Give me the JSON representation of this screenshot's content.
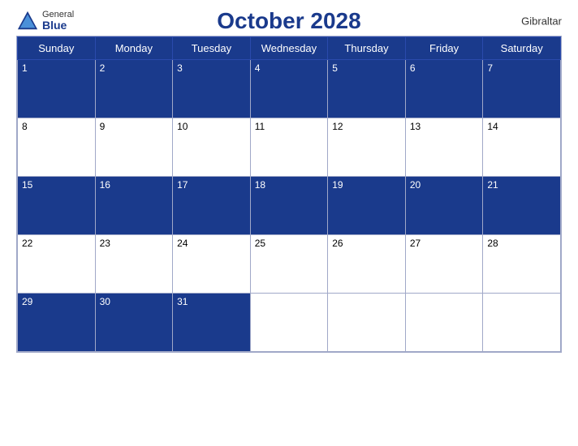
{
  "logo": {
    "general": "General",
    "blue": "Blue"
  },
  "title": "October 2028",
  "country": "Gibraltar",
  "days_of_week": [
    "Sunday",
    "Monday",
    "Tuesday",
    "Wednesday",
    "Thursday",
    "Friday",
    "Saturday"
  ],
  "weeks": [
    [
      {
        "day": 1,
        "blue": true
      },
      {
        "day": 2,
        "blue": true
      },
      {
        "day": 3,
        "blue": true
      },
      {
        "day": 4,
        "blue": true
      },
      {
        "day": 5,
        "blue": true
      },
      {
        "day": 6,
        "blue": true
      },
      {
        "day": 7,
        "blue": true
      }
    ],
    [
      {
        "day": 8,
        "blue": false
      },
      {
        "day": 9,
        "blue": false
      },
      {
        "day": 10,
        "blue": false
      },
      {
        "day": 11,
        "blue": false
      },
      {
        "day": 12,
        "blue": false
      },
      {
        "day": 13,
        "blue": false
      },
      {
        "day": 14,
        "blue": false
      }
    ],
    [
      {
        "day": 15,
        "blue": true
      },
      {
        "day": 16,
        "blue": true
      },
      {
        "day": 17,
        "blue": true
      },
      {
        "day": 18,
        "blue": true
      },
      {
        "day": 19,
        "blue": true
      },
      {
        "day": 20,
        "blue": true
      },
      {
        "day": 21,
        "blue": true
      }
    ],
    [
      {
        "day": 22,
        "blue": false
      },
      {
        "day": 23,
        "blue": false
      },
      {
        "day": 24,
        "blue": false
      },
      {
        "day": 25,
        "blue": false
      },
      {
        "day": 26,
        "blue": false
      },
      {
        "day": 27,
        "blue": false
      },
      {
        "day": 28,
        "blue": false
      }
    ],
    [
      {
        "day": 29,
        "blue": true
      },
      {
        "day": 30,
        "blue": true
      },
      {
        "day": 31,
        "blue": true
      },
      {
        "day": null,
        "blue": false
      },
      {
        "day": null,
        "blue": false
      },
      {
        "day": null,
        "blue": false
      },
      {
        "day": null,
        "blue": false
      }
    ]
  ]
}
